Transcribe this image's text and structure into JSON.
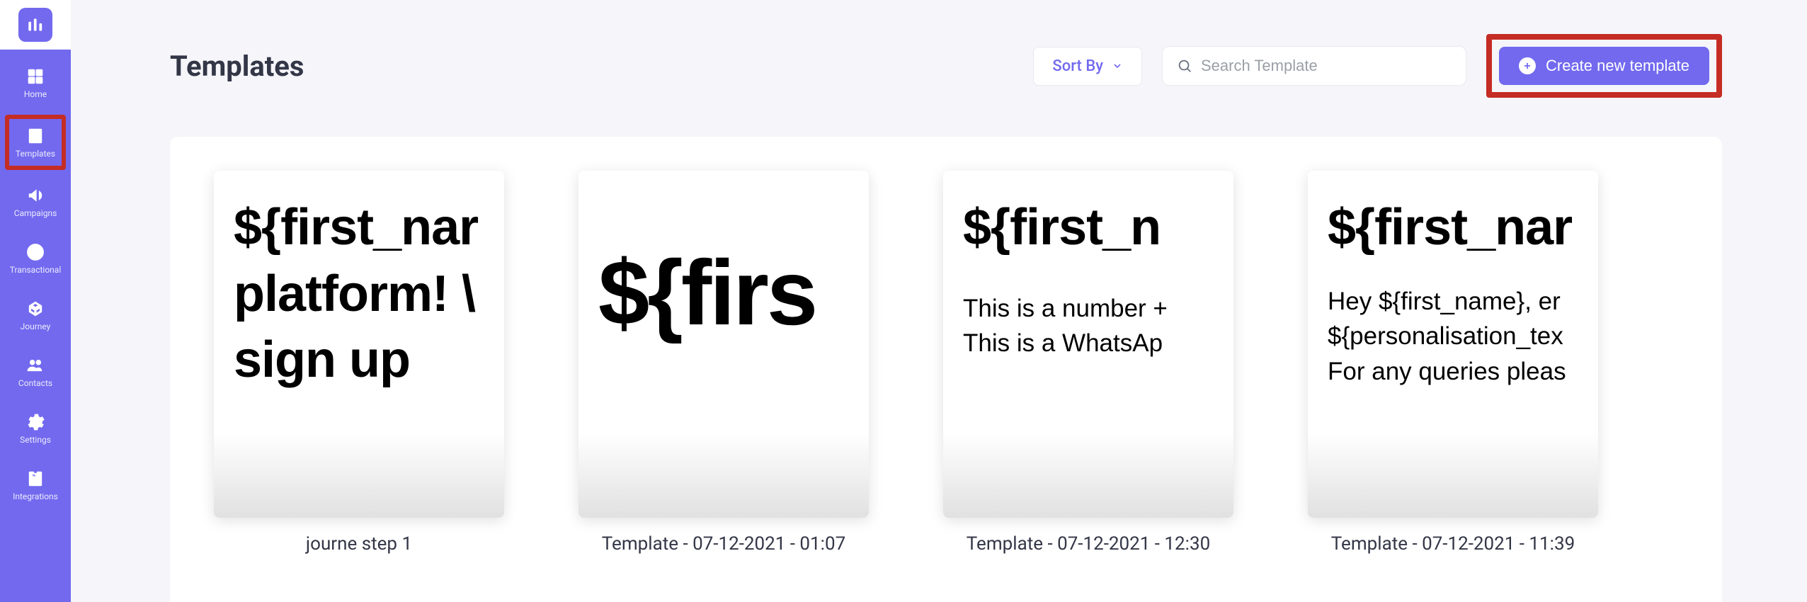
{
  "sidebar": {
    "items": [
      {
        "id": "home",
        "label": "Home"
      },
      {
        "id": "templates",
        "label": "Templates"
      },
      {
        "id": "campaigns",
        "label": "Campaigns"
      },
      {
        "id": "transactional",
        "label": "Transactional"
      },
      {
        "id": "journey",
        "label": "Journey"
      },
      {
        "id": "contacts",
        "label": "Contacts"
      },
      {
        "id": "settings",
        "label": "Settings"
      },
      {
        "id": "integrations",
        "label": "Integrations"
      }
    ]
  },
  "header": {
    "title": "Templates",
    "sortLabel": "Sort By",
    "searchPlaceholder": "Search Template",
    "createLabel": "Create new template"
  },
  "templates": [
    {
      "label": "journe step 1",
      "previewBig": [
        "${first_nar",
        "platform! \\",
        "sign up"
      ],
      "previewSmall": []
    },
    {
      "label": "Template - 07-12-2021 - 01:07",
      "previewHuge": "${firs",
      "previewBig": [],
      "previewSmall": []
    },
    {
      "label": "Template - 07-12-2021 - 12:30",
      "previewBig": [
        "${first_n"
      ],
      "previewSmall": [
        "This is a number +",
        "This is a WhatsAp"
      ]
    },
    {
      "label": "Template - 07-12-2021 - 11:39",
      "previewBig": [
        "${first_nar"
      ],
      "previewSmall": [
        "Hey ${first_name}, er",
        "${personalisation_tex",
        "For any queries pleas"
      ]
    }
  ]
}
